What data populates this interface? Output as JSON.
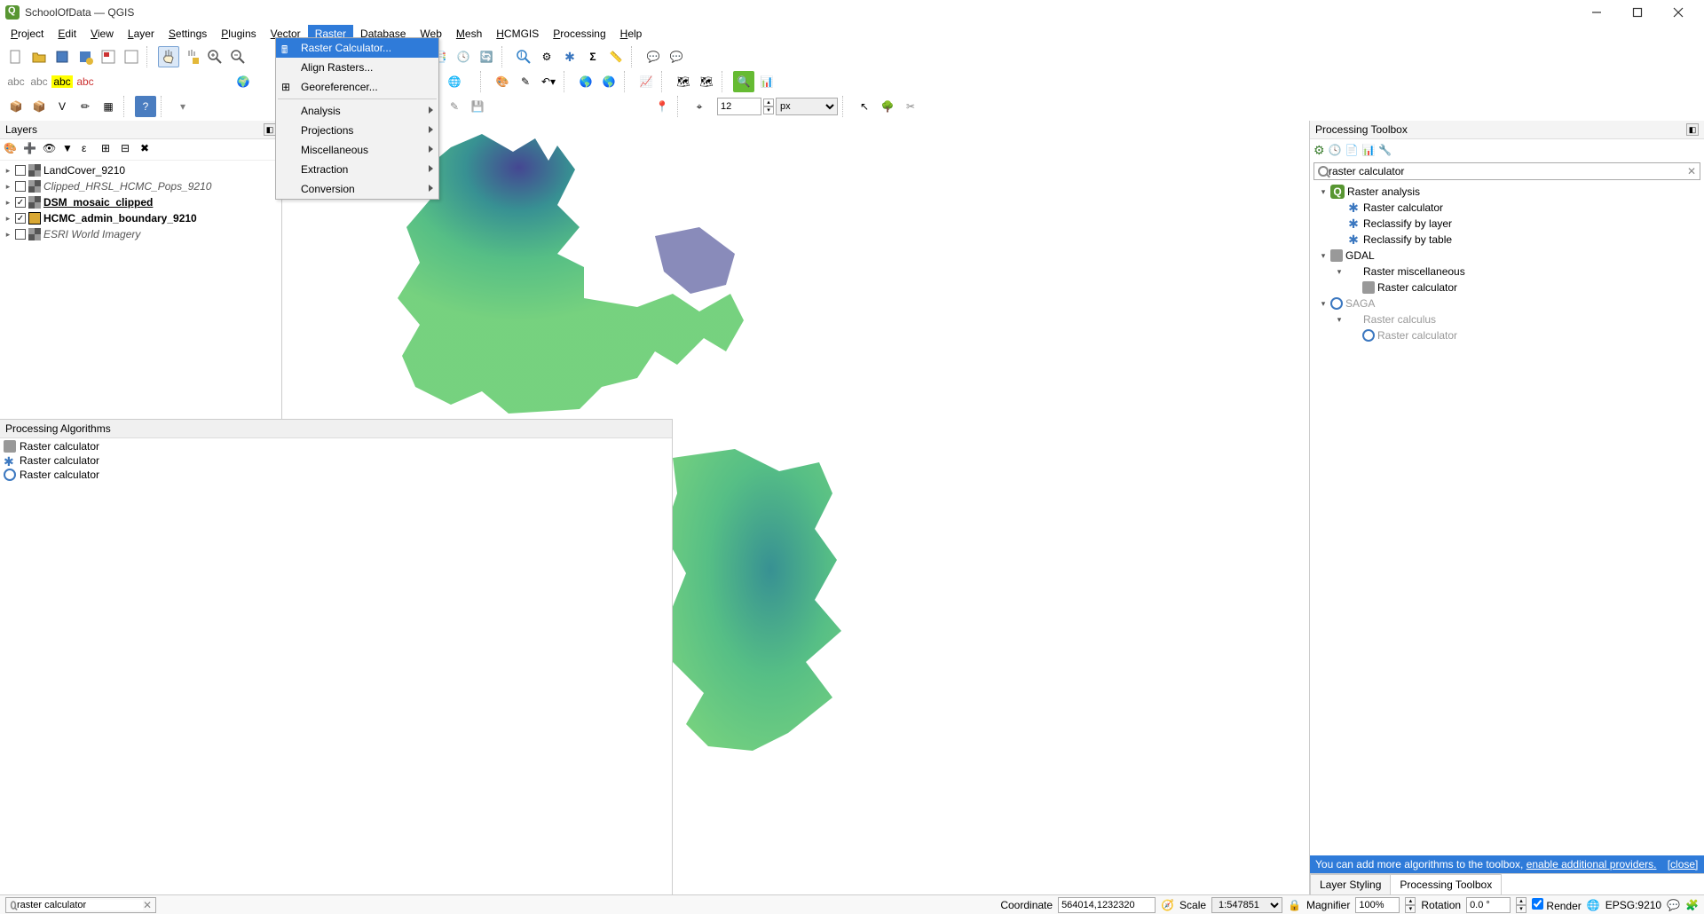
{
  "window": {
    "title": "SchoolOfData — QGIS"
  },
  "menu": {
    "items": [
      "Project",
      "Edit",
      "View",
      "Layer",
      "Settings",
      "Plugins",
      "Vector",
      "Raster",
      "Database",
      "Web",
      "Mesh",
      "HCMGIS",
      "Processing",
      "Help"
    ],
    "active_index": 7
  },
  "raster_menu": {
    "items": [
      {
        "label": "Raster Calculator...",
        "highlight": true,
        "icon": "calc"
      },
      {
        "label": "Align Rasters..."
      },
      {
        "label": "Georeferencer...",
        "icon": "georef"
      },
      {
        "label": "Analysis",
        "submenu": true
      },
      {
        "label": "Projections",
        "submenu": true
      },
      {
        "label": "Miscellaneous",
        "submenu": true
      },
      {
        "label": "Extraction",
        "submenu": true
      },
      {
        "label": "Conversion",
        "submenu": true
      }
    ]
  },
  "layers_panel": {
    "title": "Layers",
    "items": [
      {
        "expand": true,
        "checked": false,
        "icon": "raster",
        "name": "LandCover_9210"
      },
      {
        "expand": true,
        "checked": false,
        "icon": "raster",
        "name": "Clipped_HRSL_HCMC_Pops_9210",
        "italic": true
      },
      {
        "expand": false,
        "checked": true,
        "icon": "raster",
        "name": "DSM_mosaic_clipped",
        "bold": true
      },
      {
        "expand": false,
        "checked": true,
        "icon": "poly",
        "name": "HCMC_admin_boundary_9210",
        "boldplain": true
      },
      {
        "expand": true,
        "checked": false,
        "icon": "raster",
        "name": "ESRI World Imagery",
        "italic": true
      }
    ]
  },
  "proc_algos": {
    "title": "Processing Algorithms",
    "items": [
      {
        "icon": "gdal",
        "label": "Raster calculator"
      },
      {
        "icon": "qgis",
        "label": "Raster calculator"
      },
      {
        "icon": "saga",
        "label": "Raster calculator"
      }
    ]
  },
  "toolbox": {
    "title": "Processing Toolbox",
    "search": "raster calculator",
    "tree": [
      {
        "level": 0,
        "tri": "down",
        "icon": "qgis",
        "label": "Raster analysis"
      },
      {
        "level": 1,
        "icon": "gear-blue",
        "label": "Raster calculator"
      },
      {
        "level": 1,
        "icon": "gear-blue",
        "label": "Reclassify by layer"
      },
      {
        "level": 1,
        "icon": "gear-blue",
        "label": "Reclassify by table"
      },
      {
        "level": 0,
        "tri": "down",
        "icon": "gdal",
        "label": "GDAL"
      },
      {
        "level": 1,
        "tri": "down",
        "label": "Raster miscellaneous"
      },
      {
        "level": 2,
        "icon": "gdal",
        "label": "Raster calculator"
      },
      {
        "level": 0,
        "tri": "down",
        "icon": "saga",
        "label": "SAGA",
        "dim": true
      },
      {
        "level": 1,
        "tri": "down",
        "label": "Raster calculus",
        "dim": true
      },
      {
        "level": 2,
        "icon": "saga",
        "label": "Raster calculator",
        "dim": true
      }
    ],
    "hint_prefix": "You can add more algorithms to the toolbox, ",
    "hint_link": "enable additional providers.",
    "hint_close": "[close]",
    "tabs": [
      "Layer Styling",
      "Processing Toolbox"
    ],
    "active_tab": 1
  },
  "toolbar_values": {
    "font_size": "12",
    "font_unit": "px"
  },
  "statusbar": {
    "search": "raster calculator",
    "coord_label": "Coordinate",
    "coord": "564014,1232320",
    "scale_label": "Scale",
    "scale": "1:547851",
    "mag_label": "Magnifier",
    "mag": "100%",
    "rot_label": "Rotation",
    "rot": "0.0 °",
    "render": "Render",
    "crs": "EPSG:9210"
  }
}
